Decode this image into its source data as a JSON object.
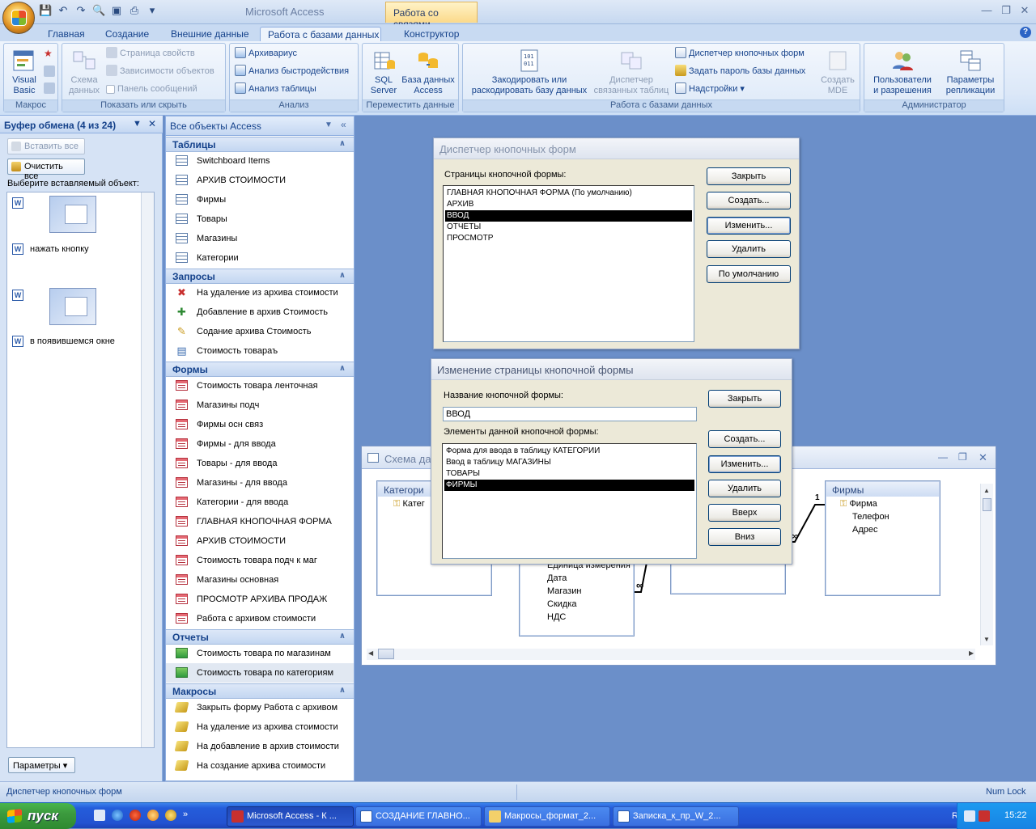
{
  "window": {
    "title": "Microsoft Access",
    "context_tab": "Работа со связями"
  },
  "tabs": [
    "Главная",
    "Создание",
    "Внешние данные",
    "Работа с базами данных",
    "Конструктор"
  ],
  "ribbon": {
    "groups": [
      "Макрос",
      "Показать или скрыть",
      "Анализ",
      "Переместить данные",
      "Работа с базами данных",
      "Администратор"
    ],
    "visual_basic": "Visual\nBasic",
    "schema": "Схема\nданных",
    "props": "Страница свойств",
    "deps": "Зависимости объектов",
    "msgbar": "Панель сообщений",
    "archiver": "Архивариус",
    "perf": "Анализ быстродействия",
    "tbl_analyze": "Анализ таблицы",
    "sql": "SQL\nServer",
    "access_db": "База данных\nAccess",
    "encode": "Закодировать или\nраскодировать базу данных",
    "linked_mgr": "Диспетчер\nсвязанных таблиц",
    "switchboard_mgr": "Диспетчер кнопочных форм",
    "set_pwd": "Задать пароль базы данных",
    "addins": "Надстройки",
    "mde": "Создать\nMDE",
    "users": "Пользователи\nи разрешения",
    "replication": "Параметры\nрепликации"
  },
  "clipboard": {
    "header": "Буфер обмена (4 из 24)",
    "paste_all": "Вставить все",
    "clear_all": "Очистить все",
    "prompt": "Выберите вставляемый объект:",
    "items": [
      "нажать кнопку",
      "в появившемся окне"
    ],
    "params": "Параметры"
  },
  "nav": {
    "header": "Все объекты Access",
    "sections": [
      {
        "name": "Таблицы",
        "items": [
          "Switchboard Items",
          "АРХИВ СТОИМОСТИ",
          "Фирмы",
          "Товары",
          "Магазины",
          "Категории"
        ]
      },
      {
        "name": "Запросы",
        "items": [
          "На удаление из архива стоимости",
          "Добавление в архив Стоимость",
          "Содание архива Стоимость",
          "Стоимость товараъ"
        ]
      },
      {
        "name": "Формы",
        "items": [
          "Стоимость товара ленточная",
          "Магазины подч",
          "Фирмы осн связ",
          "Фирмы - для ввода",
          "Товары - для ввода",
          "Магазины - для ввода",
          "Категории - для ввода",
          "ГЛАВНАЯ КНОПОЧНАЯ ФОРМА",
          "АРХИВ СТОИМОСТИ",
          "Стоимость товара подч к маг",
          "Магазины основная",
          "ПРОСМОТР АРХИВА ПРОДАЖ",
          "Работа с архивом стоимости"
        ]
      },
      {
        "name": "Отчеты",
        "items": [
          "Стоимость товара по магазинам",
          "Стоимость товара по категориям"
        ]
      },
      {
        "name": "Макросы",
        "items": [
          "Закрыть форму Работа с архивом",
          "На удаление из архива стоимости",
          "На добавление в архив стоимости",
          "На создание архива стоимости"
        ]
      }
    ]
  },
  "dlg1": {
    "title": "Диспетчер кнопочных форм",
    "label": "Страницы кнопочной формы:",
    "rows": [
      "ГЛАВНАЯ КНОПОЧНАЯ ФОРМА (По умолчанию)",
      "АРХИВ",
      "ВВОД",
      "ОТЧЕТЫ",
      "ПРОСМОТР"
    ],
    "buttons": [
      "Закрыть",
      "Создать...",
      "Изменить...",
      "Удалить",
      "По умолчанию"
    ]
  },
  "dlg2": {
    "title": "Изменение страницы кнопочной формы",
    "name_label": "Название кнопочной формы:",
    "name_value": "ВВОД",
    "items_label": "Элементы данной кнопочной формы:",
    "rows": [
      "Форма для ввода в таблицу КАТЕГОРИИ",
      "Ввод в таблицу МАГАЗИНЫ",
      "ТОВАРЫ",
      "ФИРМЫ"
    ],
    "buttons": [
      "Закрыть",
      "Создать...",
      "Изменить...",
      "Удалить",
      "Вверх",
      "Вниз"
    ]
  },
  "schema": {
    "title": "Схема да",
    "cat_table": "Категори",
    "cat_field": "Катег",
    "mid_fields": [
      "Единица измерения",
      "Дата",
      "Магазин",
      "Скидка",
      "НДС"
    ],
    "firms_table": "Фирмы",
    "firms_fields": [
      "Фирма",
      "Телефон",
      "Адрес"
    ],
    "one": "1",
    "many": "∞"
  },
  "status": {
    "left": "Диспетчер кнопочных форм",
    "right": "Num Lock"
  },
  "taskbar": {
    "start": "пуск",
    "buttons": [
      "Microsoft Access - К ...",
      "СОЗДАНИЕ ГЛАВНО...",
      "Макросы_формат_2...",
      "Записка_к_пр_W_2..."
    ],
    "lang": "RL",
    "time": "15:22"
  }
}
